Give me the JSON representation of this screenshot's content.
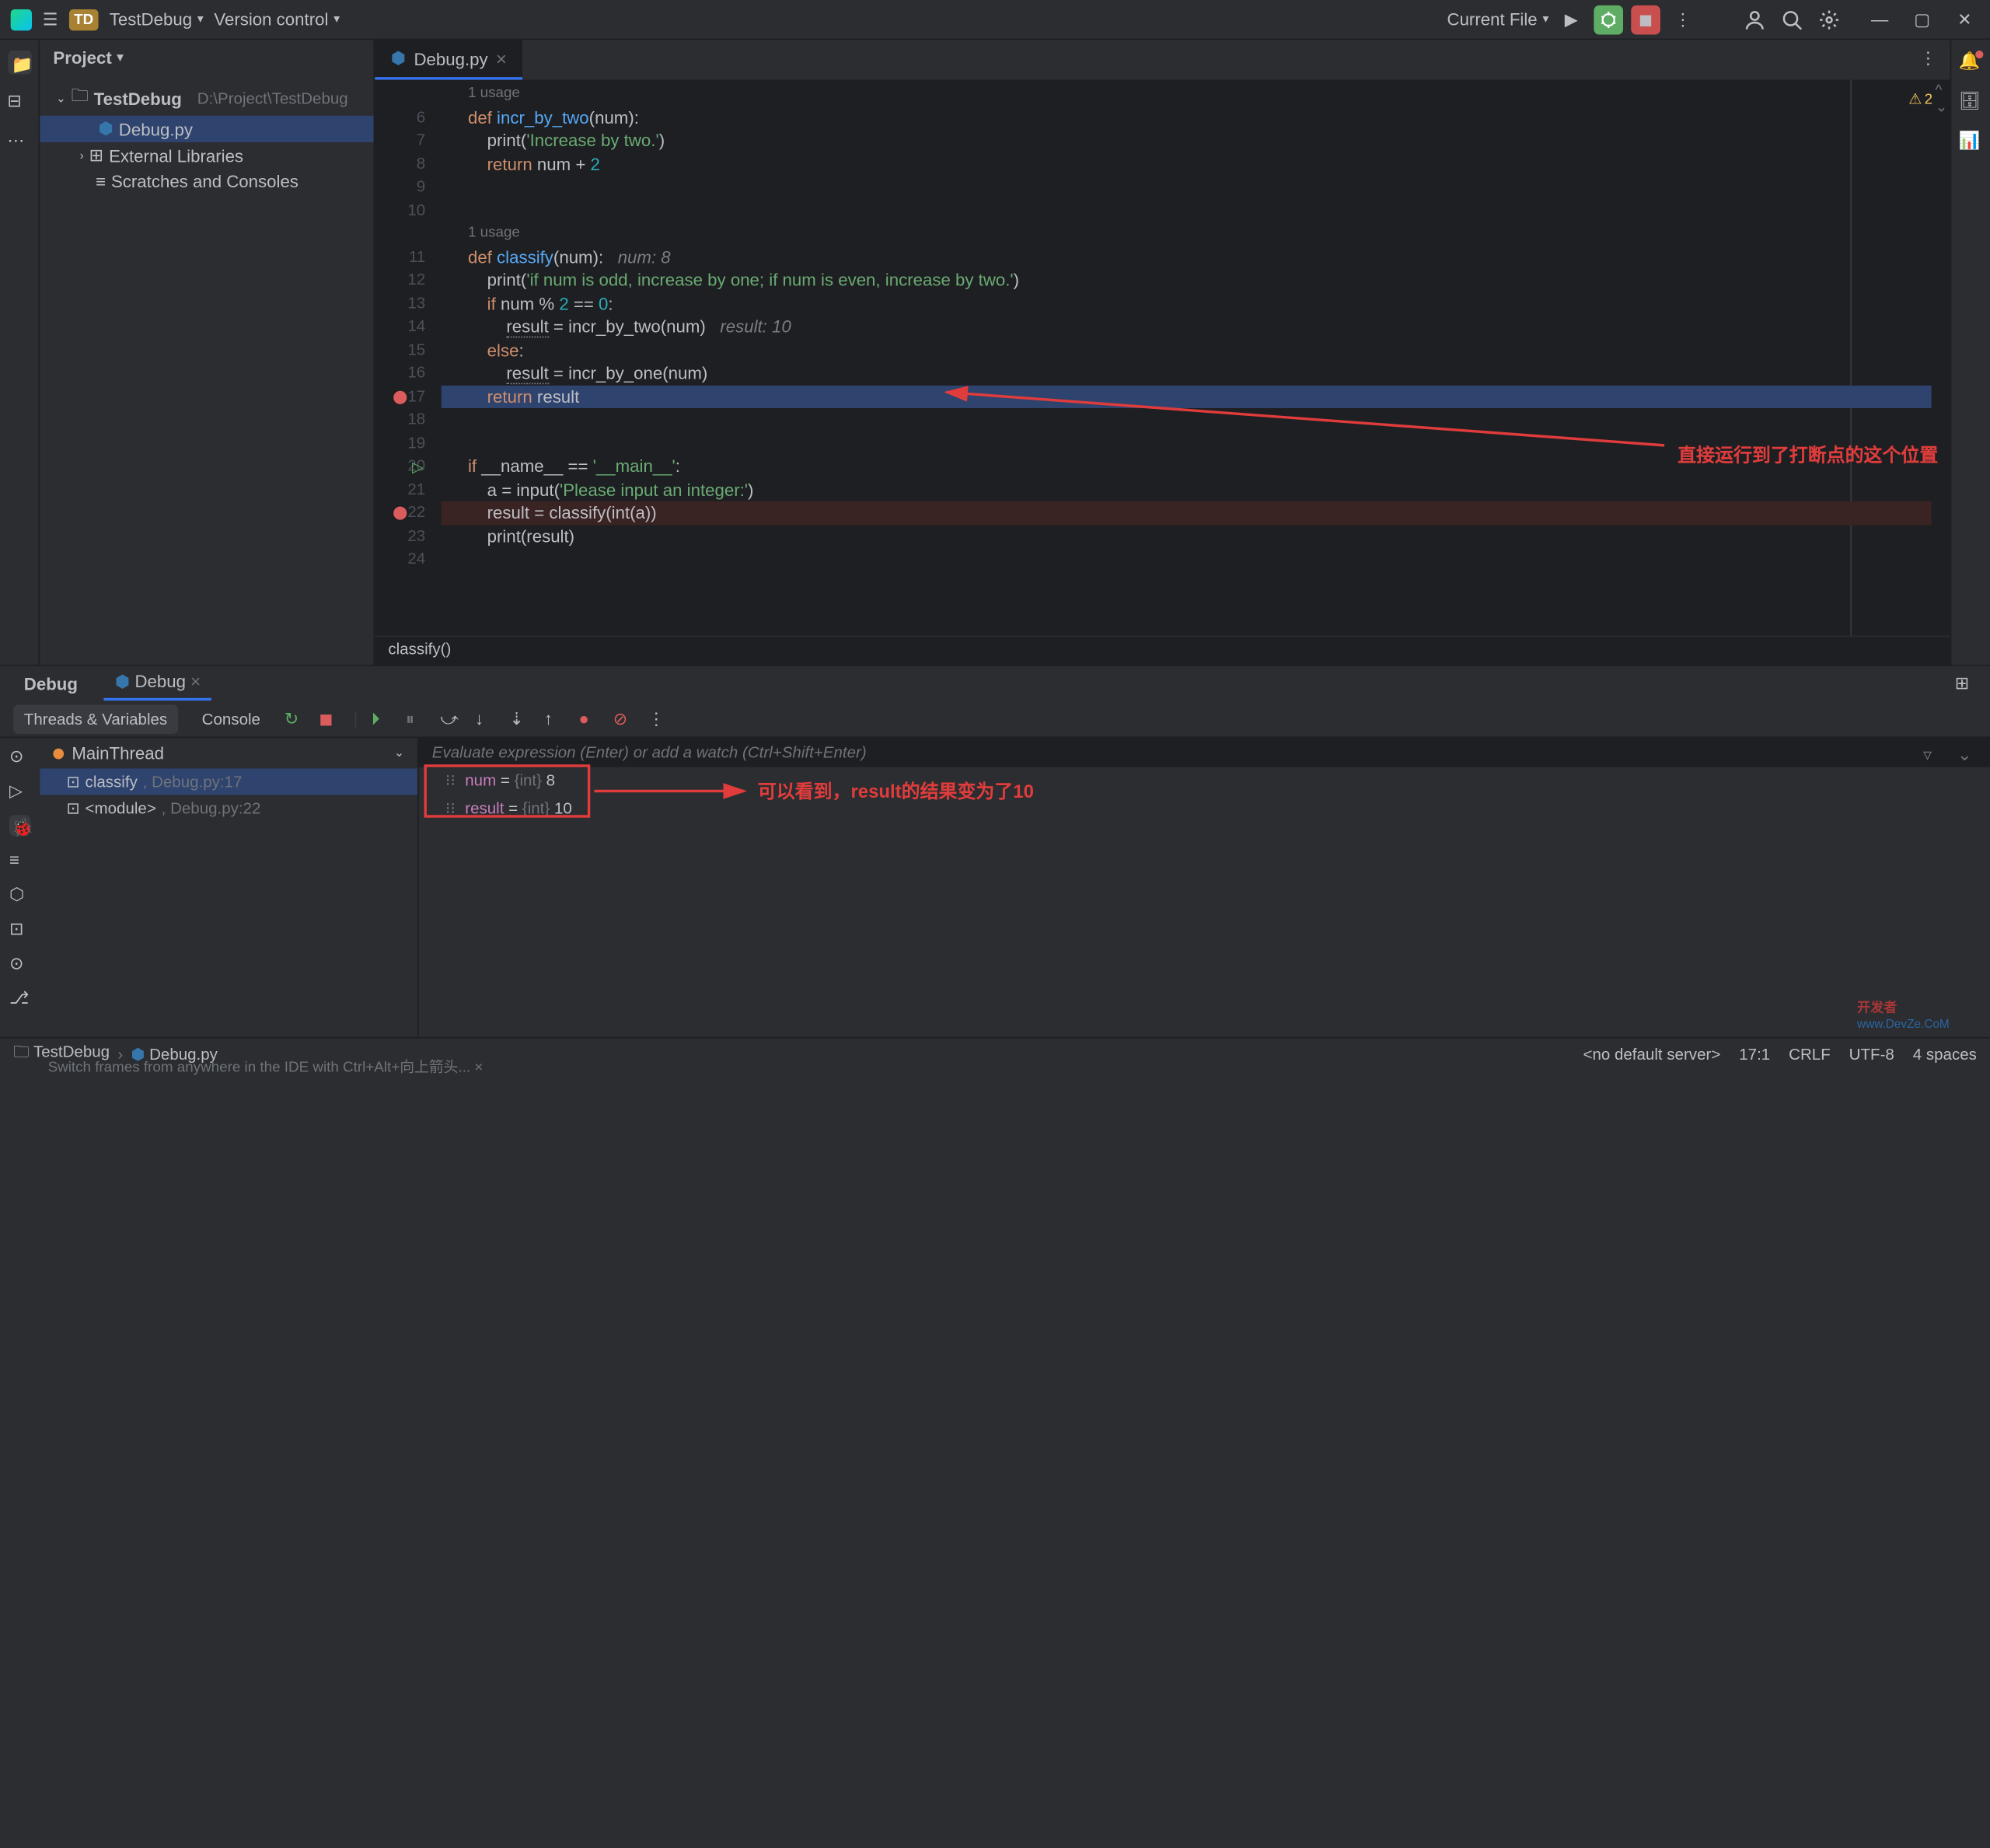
{
  "titlebar": {
    "project_badge": "TD",
    "project_name": "TestDebug",
    "version_control": "Version control",
    "current_file": "Current File"
  },
  "project_tree": {
    "header": "Project",
    "root_name": "TestDebug",
    "root_path": "D:\\Project\\TestDebug",
    "file1": "Debug.py",
    "external": "External Libraries",
    "scratches": "Scratches and Consoles"
  },
  "tab": {
    "name": "Debug.py"
  },
  "editor": {
    "usage1": "1 usage",
    "usage2": "1 usage",
    "l6": {
      "def": "def ",
      "fn": "incr_by_two",
      "rest": "(num):"
    },
    "l7": {
      "p1": "    print(",
      "str": "'Increase by two.'",
      "p2": ")"
    },
    "l8": {
      "ret": "    return ",
      "var": "num ",
      "op": "+ ",
      "num": "2"
    },
    "l11": {
      "def": "def ",
      "fn": "classify",
      "rest": "(num):",
      "hint": "   num: 8"
    },
    "l12": {
      "p1": "    print(",
      "str": "'if num is odd, increase by one; if num is even, increase by two.'",
      "p2": ")"
    },
    "l13": {
      "p1": "    if ",
      "var": "num % ",
      "n1": "2",
      "eq": " == ",
      "n2": "0",
      "p2": ":"
    },
    "l14": {
      "p1": "        ",
      "res": "result",
      "p2": " = incr_by_two(num)",
      "hint": "   result: 10"
    },
    "l15": {
      "p1": "    else",
      "p2": ":"
    },
    "l16": {
      "p1": "        ",
      "res": "result",
      "p2": " = incr_by_one(num)"
    },
    "l17": {
      "p1": "    return ",
      "var": "result"
    },
    "l20": {
      "p1": "if ",
      "name": "__name__ ",
      "eq": "== ",
      "str": "'__main__'",
      "p2": ":"
    },
    "l21": {
      "p1": "    a = input(",
      "str": "'Please input an integer:'",
      "p2": ")"
    },
    "l22": {
      "p1": "    result = classify(int(a))"
    },
    "l23": {
      "p1": "    print(result)"
    },
    "breadcrumb": "classify()"
  },
  "inspection": {
    "count": "2"
  },
  "debug": {
    "tab_debug": "Debug",
    "tab_config": "Debug",
    "sub_threads": "Threads & Variables",
    "sub_console": "Console",
    "thread": "MainThread",
    "frame1_fn": "classify",
    "frame1_loc": ", Debug.py:17",
    "frame2_fn": "<module>",
    "frame2_loc": ", Debug.py:22",
    "eval_placeholder": "Evaluate expression (Enter) or add a watch (Ctrl+Shift+Enter)",
    "var1_name": "num",
    "var1_eq": " = ",
    "var1_type": "{int} ",
    "var1_val": "8",
    "var2_name": "result",
    "var2_eq": " = ",
    "var2_type": "{int} ",
    "var2_val": "10",
    "tip": "Switch frames from anywhere in the IDE with Ctrl+Alt+向上箭头..."
  },
  "annotations": {
    "a1": "直接运行到了打断点的这个位置",
    "a2": "可以看到，result的结果变为了10"
  },
  "status": {
    "crumb1": "TestDebug",
    "crumb2": "Debug.py",
    "server": "<no default server>",
    "pos": "17:1",
    "sep": "CRLF",
    "enc": "UTF-8",
    "indent": "4 spaces"
  }
}
